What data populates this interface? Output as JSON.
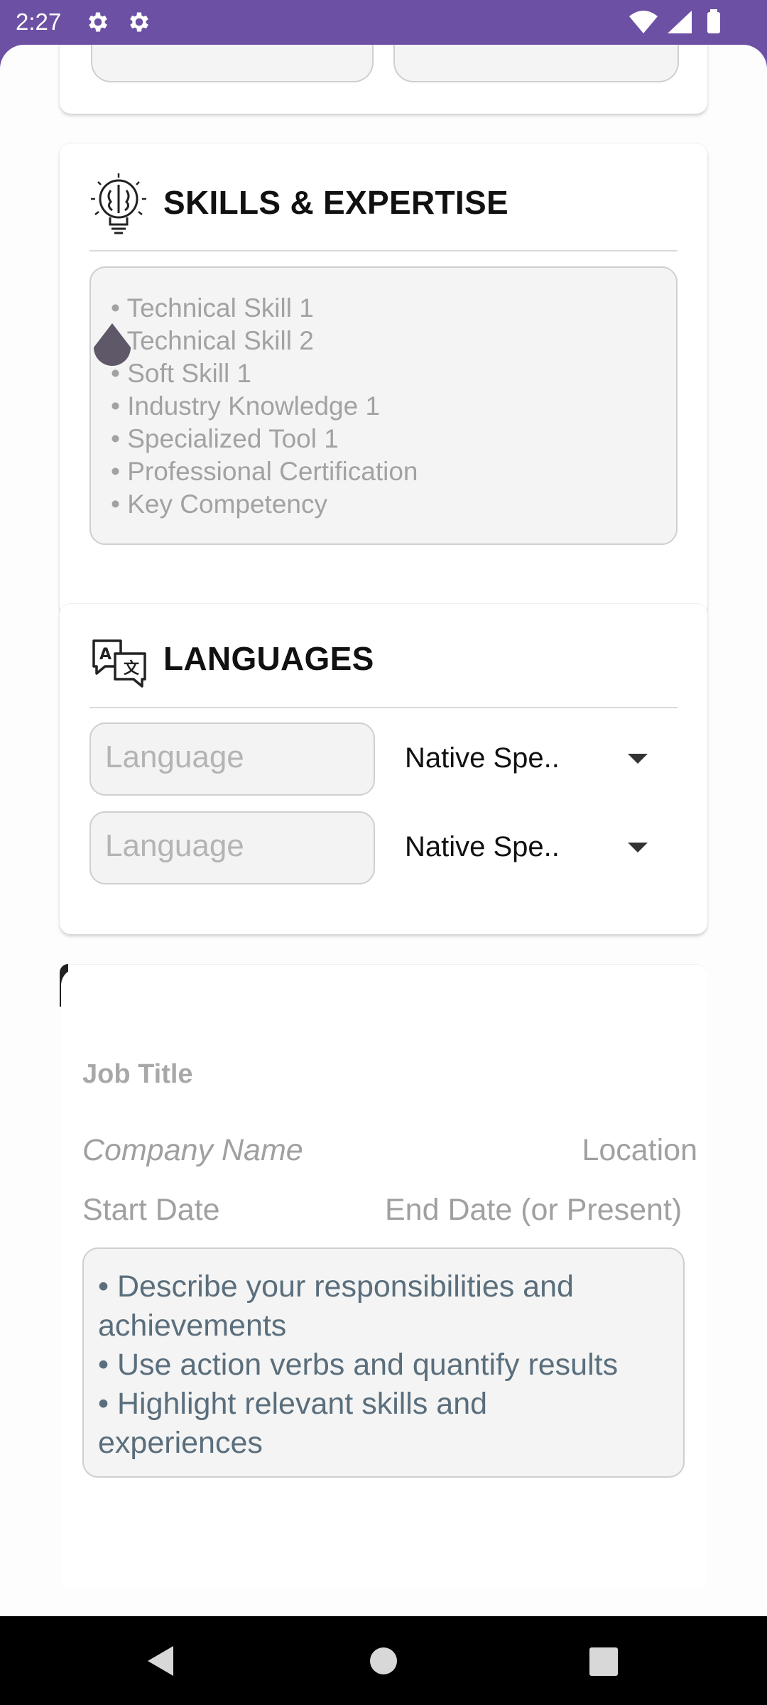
{
  "status_bar": {
    "time": "2:27",
    "icons": [
      "gear-icon",
      "gear-icon",
      "wifi-icon",
      "cell-signal-icon",
      "battery-icon"
    ]
  },
  "skills": {
    "title": "SKILLS & EXPERTISE",
    "icon": "brain-lightbulb-icon",
    "placeholder_lines": [
      "• Technical Skill 1",
      "• Technical Skill 2",
      "• Soft Skill 1",
      "• Industry Knowledge 1",
      "• Specialized Tool 1",
      "• Professional Certification",
      "• Key Competency"
    ]
  },
  "languages": {
    "title": "LANGUAGES",
    "icon": "translate-icon",
    "rows": [
      {
        "placeholder": "Language",
        "level": "Native Spe.."
      },
      {
        "placeholder": "Language",
        "level": "Native Spe.."
      }
    ]
  },
  "experience": {
    "job_title_placeholder": "Job Title",
    "company_placeholder": "Company Name",
    "location_placeholder": "Location",
    "start_placeholder": "Start Date",
    "end_placeholder": "End Date (or Present)",
    "description_placeholder_lines": [
      "• Describe your responsibilities and",
      "achievements",
      "• Use action verbs and quantify results",
      "• Highlight relevant skills and",
      "experiences"
    ]
  },
  "colors": {
    "status_bar": "#6c50a4",
    "cursor_handle": "#5e5868"
  }
}
